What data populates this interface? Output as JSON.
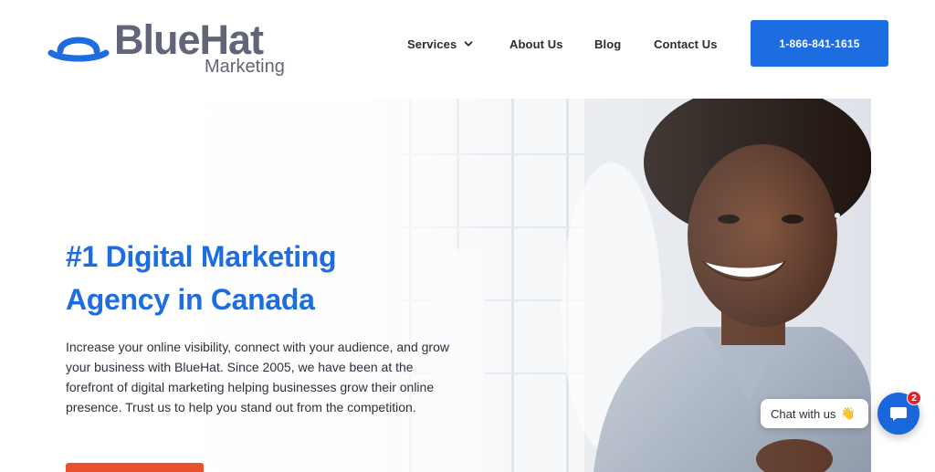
{
  "brand": {
    "name": "BlueHat",
    "sub": "Marketing",
    "color": "#626477",
    "hat_color": "#1d6ce0"
  },
  "nav": {
    "services": "Services",
    "about": "About Us",
    "blog": "Blog",
    "contact": "Contact Us",
    "phone": "1-866-841-1615"
  },
  "hero": {
    "title_line1": "#1 Digital Marketing",
    "title_line2": "Agency in Canada",
    "description": "Increase your online visibility, connect with your audience, and grow your business with BlueHat. Since 2005, we have been at the forefront of digital marketing helping businesses grow their online presence. Trust us to help you stand out from the competition.",
    "accent_color": "#1d6ce0",
    "cta_color": "#e9502e"
  },
  "chat": {
    "label": "Chat with us",
    "emoji": "👋",
    "badge_count": "2"
  },
  "icons": {
    "services_caret": "chevron-down-icon",
    "chat": "chat-icon",
    "logo": "hat-icon"
  }
}
